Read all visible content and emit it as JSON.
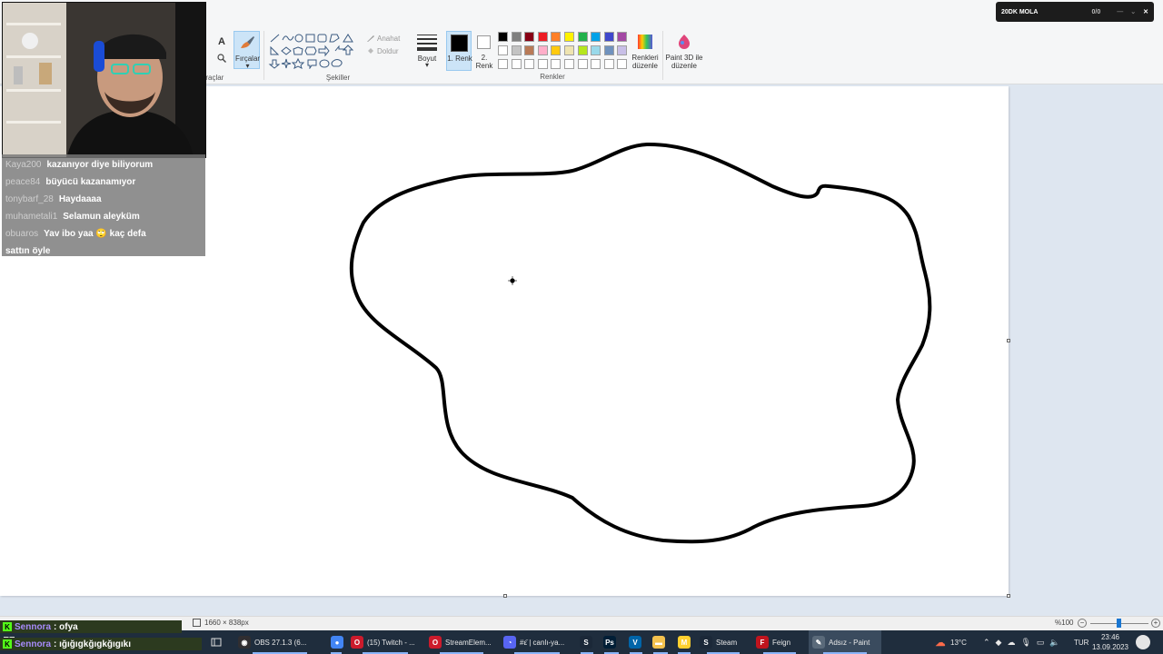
{
  "ribbon": {
    "tools_label": "Araçlar",
    "brushes_label": "Fırçalar",
    "shapes_label": "Şekiller",
    "outline_label": "Anahat",
    "fill_label": "Doldur",
    "size_label": "Boyut",
    "color1_label": "1. Renk",
    "color2_label": "2. Renk",
    "colors_group_label": "Renkler",
    "edit_colors_label": "Renkleri düzenle",
    "paint3d_label": "Paint 3D ile düzenle",
    "palette_row1": [
      "#000000",
      "#7f7f7f",
      "#880015",
      "#ed1c24",
      "#ff7f27",
      "#fff200",
      "#22b14c",
      "#00a2e8",
      "#3f48cc",
      "#a349a4"
    ],
    "palette_row2": [
      "#ffffff",
      "#c3c3c3",
      "#b97a57",
      "#ffaec9",
      "#ffc90e",
      "#efe4b0",
      "#b5e61d",
      "#99d9ea",
      "#7092be",
      "#c8bfe7"
    ],
    "palette_row3": [
      "#ffffff",
      "#ffffff",
      "#ffffff",
      "#ffffff",
      "#ffffff",
      "#ffffff",
      "#ffffff",
      "#ffffff",
      "#ffffff",
      "#ffffff"
    ],
    "color1": "#000000",
    "color2": "#ffffff"
  },
  "timer": {
    "title": "20DK MOLA",
    "count": "0/0"
  },
  "chat": {
    "lines": [
      {
        "user": "Kaya200",
        "text": "kazanıyor diye biliyorum"
      },
      {
        "user": "peace84",
        "text": "büyücü kazanamıyor"
      },
      {
        "user": "tonybarf_28",
        "text": "Haydaaaa"
      },
      {
        "user": "muhametali1",
        "text": "Selamun aleyküm"
      },
      {
        "user": "obuaros",
        "text": "Yav ibo yaa 🙄 kaç defa"
      },
      {
        "user": "",
        "text": "sattın öyle"
      }
    ]
  },
  "bottom_chat": [
    {
      "user": "Sennora",
      "text": ": ofya"
    },
    {
      "user": "Sennora",
      "text": ": ığığıgkğıgkğıgıkı"
    }
  ],
  "statusbar": {
    "dimensions": "1660 × 838px",
    "zoom": "%100"
  },
  "taskbar": {
    "items": [
      {
        "label": "OBS 27.1.3 (6...",
        "icon": "obs-icon",
        "color": "#302e31"
      },
      {
        "label": "",
        "icon": "chrome-icon",
        "color": "#4285f4"
      },
      {
        "label": "(15) Twitch - ...",
        "icon": "opera-icon",
        "color": "#cc1b2c"
      },
      {
        "label": "StreamElem...",
        "icon": "opera-icon",
        "color": "#cc1b2c"
      },
      {
        "label": "#ε̈ | canlı-ya...",
        "icon": "discord-icon",
        "color": "#5865f2"
      },
      {
        "label": "",
        "icon": "steam-icon",
        "color": "#1b2838"
      },
      {
        "label": "",
        "icon": "photoshop-icon",
        "color": "#001e36"
      },
      {
        "label": "",
        "icon": "vscode-icon",
        "color": "#0065a9"
      },
      {
        "label": "",
        "icon": "folder-icon",
        "color": "#f2c14e"
      },
      {
        "label": "",
        "icon": "miro-icon",
        "color": "#ffd02f"
      },
      {
        "label": "Steam",
        "icon": "steam-icon",
        "color": "#1b2838"
      },
      {
        "label": "Feign",
        "icon": "feign-icon",
        "color": "#c0141e"
      },
      {
        "label": "Adsız - Paint",
        "icon": "paint-icon",
        "color": "#5a6a7a"
      }
    ],
    "weather": "13°C",
    "language": "TUR",
    "time": "23:46",
    "date": "13.09.2023"
  }
}
